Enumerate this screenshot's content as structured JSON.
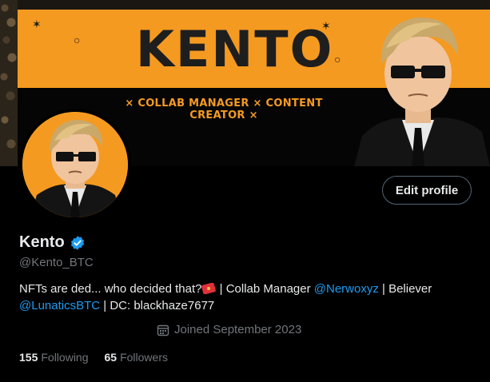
{
  "banner": {
    "title": "KENTO",
    "tagline": "× COLLAB MANAGER × CONTENT CREATOR ×"
  },
  "profile": {
    "name": "Kento",
    "handle": "@Kento_BTC",
    "edit_button": "Edit profile",
    "bio": {
      "part1": "NFTs are ded... who decided that?",
      "part2": " | Collab Manager ",
      "mention1": "@Nerwoxyz",
      "part3": " | Believer",
      "mention2": "@LunaticsBTC",
      "part4": " | DC: blackhaze7677"
    },
    "joined": "Joined September 2023",
    "following_count": "155",
    "following_label": "Following",
    "followers_count": "65",
    "followers_label": "Followers"
  },
  "colors": {
    "accent": "#1d9bf0",
    "banner_orange": "#f59a20",
    "muted_text": "#71767b"
  }
}
